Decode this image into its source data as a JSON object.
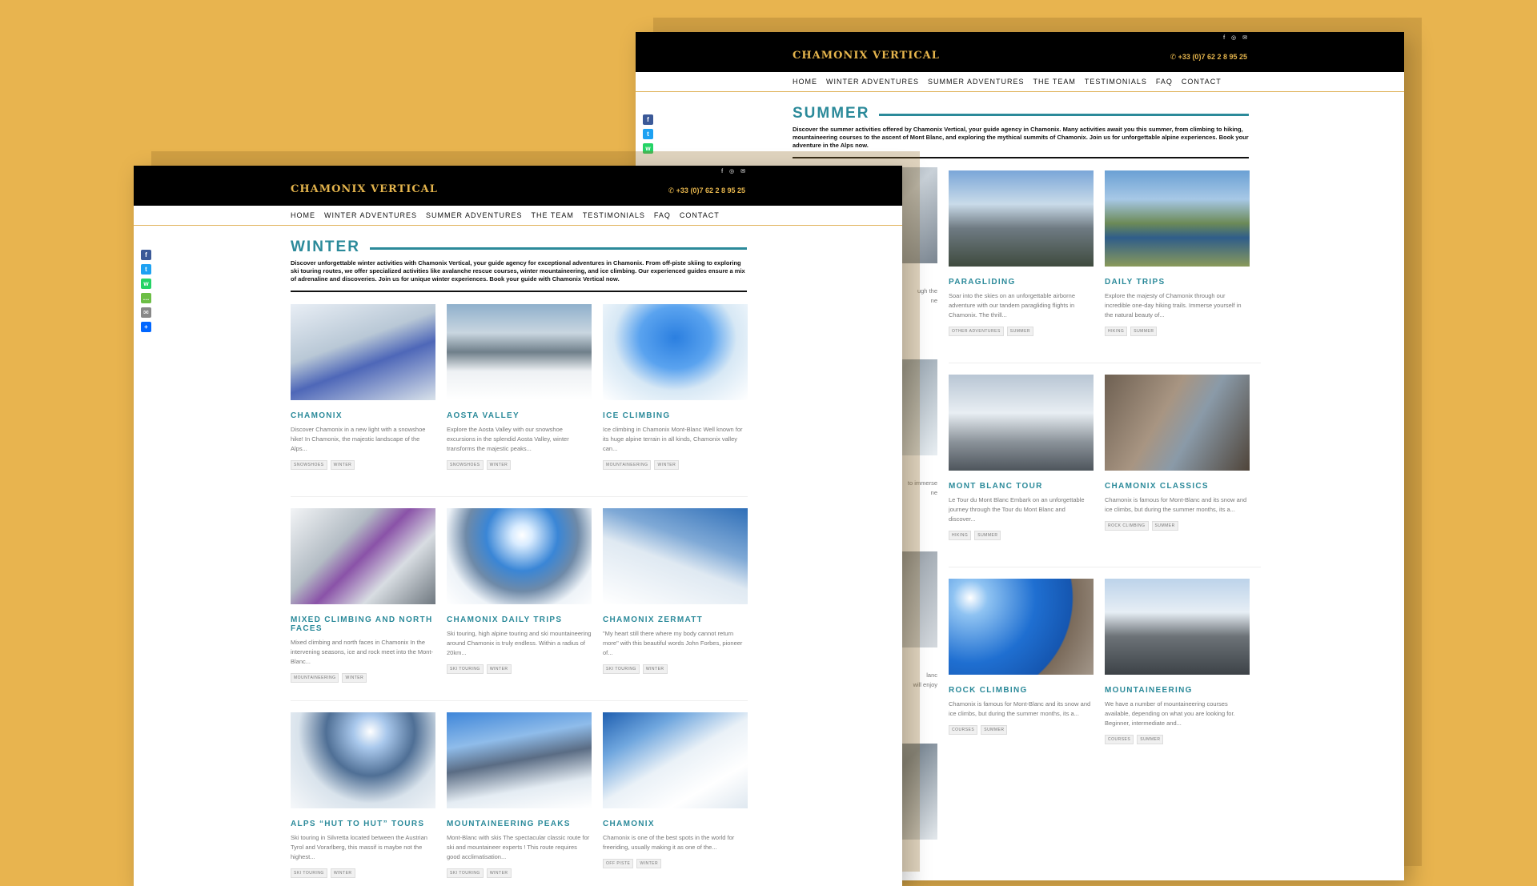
{
  "brand": "CHAMONIX VERTICAL",
  "phone": "+33 (0)7 62 2 8 95 25",
  "nav": [
    "HOME",
    "WINTER ADVENTURES",
    "SUMMER ADVENTURES",
    "THE TEAM",
    "TESTIMONIALS",
    "FAQ",
    "CONTACT"
  ],
  "social_top": [
    "f",
    "◎",
    "✉"
  ],
  "share_icons": [
    {
      "name": "facebook-share-icon",
      "glyph": "f",
      "color": "#3B5998"
    },
    {
      "name": "twitter-share-icon",
      "glyph": "t",
      "color": "#1DA1F2"
    },
    {
      "name": "whatsapp-share-icon",
      "glyph": "w",
      "color": "#25D366"
    },
    {
      "name": "sms-share-icon",
      "glyph": "…",
      "color": "#6CBE45"
    },
    {
      "name": "email-share-icon",
      "glyph": "✉",
      "color": "#888888"
    },
    {
      "name": "share-plus-icon",
      "glyph": "+",
      "color": "#0166FF"
    }
  ],
  "colors": {
    "background": "#E8B44F",
    "accent": "#2B8A9A",
    "brand_gold": "#E4B44C"
  },
  "summer": {
    "title": "SUMMER",
    "intro": "Discover the summer activities offered by Chamonix Vertical, your guide agency in Chamonix. Many activities await you this summer, from climbing to hiking, mountaineering courses to the ascent of Mont Blanc, and exploring the mythical summits of Chamonix. Join us for unforgettable alpine experiences. Book your adventure in the Alps now.",
    "partial_texts": [
      "ugh the",
      "ne",
      "to immerse",
      "ne",
      "lanc",
      "will enjoy"
    ],
    "cards": [
      {
        "title": "PARAGLIDING",
        "desc": "Soar into the skies on an unforgettable airborne adventure with our tandem paragliding flights in Chamonix. The thrill...",
        "tags": [
          "OTHER ADVENTURES",
          "SUMMER"
        ]
      },
      {
        "title": "DAILY TRIPS",
        "desc": "Explore the majesty of Chamonix through our incredible one-day hiking trails. Immerse yourself in the natural beauty of...",
        "tags": [
          "HIKING",
          "SUMMER"
        ]
      },
      {
        "title": "MONT BLANC TOUR",
        "desc": "Le Tour du Mont Blanc Embark on an unforgettable journey through the Tour du Mont Blanc and discover...",
        "tags": [
          "HIKING",
          "SUMMER"
        ]
      },
      {
        "title": "CHAMONIX CLASSICS",
        "desc": "Chamonix is famous for Mont-Blanc and its snow and ice climbs, but during the summer months, its a...",
        "tags": [
          "ROCK CLIMBING",
          "SUMMER"
        ]
      },
      {
        "title": "ROCK CLIMBING",
        "desc": "Chamonix is famous for Mont-Blanc and its snow and ice climbs, but during the summer months, its a...",
        "tags": [
          "COURSES",
          "SUMMER"
        ]
      },
      {
        "title": "MOUNTAINEERING",
        "desc": "We have a number of mountaineering courses available, depending on what you are looking for. Beginner, intermediate and...",
        "tags": [
          "COURSES",
          "SUMMER"
        ]
      }
    ]
  },
  "winter": {
    "title": "WINTER",
    "intro": "Discover unforgettable winter activities with Chamonix Vertical, your guide agency for exceptional adventures in Chamonix. From off-piste skiing to exploring ski touring routes, we offer specialized activities like avalanche rescue courses, winter mountaineering, and ice climbing. Our experienced guides ensure a mix of adrenaline and discoveries. Join us for unique winter experiences. Book your guide with Chamonix Vertical now.",
    "cards": [
      {
        "title": "CHAMONIX",
        "desc": "Discover Chamonix in a new light with a snowshoe hike! In Chamonix, the majestic landscape of the Alps...",
        "tags": [
          "SNOWSHOES",
          "WINTER"
        ]
      },
      {
        "title": "AOSTA VALLEY",
        "desc": "Explore the Aosta Valley with our snowshoe excursions in the splendid Aosta Valley, winter transforms the majestic peaks...",
        "tags": [
          "SNOWSHOES",
          "WINTER"
        ]
      },
      {
        "title": "ICE CLIMBING",
        "desc": "Ice climbing in Chamonix Mont-Blanc Well known for its huge alpine terrain in all kinds, Chamonix valley can...",
        "tags": [
          "MOUNTAINEERING",
          "WINTER"
        ]
      },
      {
        "title": "MIXED CLIMBING AND NORTH FACES",
        "desc": "Mixed climbing and north faces in Chamonix In the intervening seasons, ice and rock meet into the Mont-Blanc...",
        "tags": [
          "MOUNTAINEERING",
          "WINTER"
        ]
      },
      {
        "title": "CHAMONIX DAILY TRIPS",
        "desc": "Ski touring, high alpine touring and ski mountaineering around Chamonix is truly endless. Within a radius of 20km...",
        "tags": [
          "SKI TOURING",
          "WINTER"
        ]
      },
      {
        "title": "CHAMONIX ZERMATT",
        "desc": "\"My heart still there where my body cannot return more\" with this beautiful words John Forbes, pioneer of...",
        "tags": [
          "SKI TOURING",
          "WINTER"
        ]
      },
      {
        "title": "ALPS “HUT TO HUT” TOURS",
        "desc": "Ski touring in Silvretta located between the Austrian Tyrol and Vorarlberg, this massif is maybe not the highest...",
        "tags": [
          "SKI TOURING",
          "WINTER"
        ]
      },
      {
        "title": "MOUNTAINEERING PEAKS",
        "desc": "Mont-Blanc with skis The spectacular classic route for ski and mountaineer experts ! This route requires good acclimatisation...",
        "tags": [
          "SKI TOURING",
          "WINTER"
        ]
      },
      {
        "title": "CHAMONIX",
        "desc": "Chamonix is one of the best spots in the world for freeriding, usually making it as one of the...",
        "tags": [
          "OFF PISTE",
          "WINTER"
        ]
      }
    ]
  }
}
